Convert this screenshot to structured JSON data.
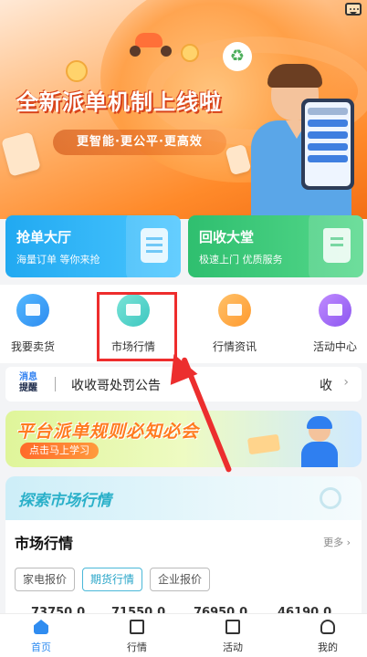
{
  "banner": {
    "title": "全新派单机制上线啦",
    "subtitle": "更智能·更公平·更高效"
  },
  "cards": [
    {
      "title": "抢单大厅",
      "subtitle": "海量订单 等你来抢",
      "color": "#21a9f1"
    },
    {
      "title": "回收大堂",
      "subtitle": "极速上门 优质服务",
      "color": "#2fbf6f"
    }
  ],
  "nav": [
    {
      "label": "我要卖货",
      "icon": "cart-icon"
    },
    {
      "label": "市场行情",
      "icon": "market-chart-icon"
    },
    {
      "label": "行情资讯",
      "icon": "news-icon"
    },
    {
      "label": "活动中心",
      "icon": "gift-icon"
    }
  ],
  "notice": {
    "tag_top": "消息",
    "tag_bottom": "提醒",
    "text": "收收哥处罚公告",
    "tail": "收"
  },
  "promo": {
    "title": "平台派单规则必知必会",
    "button": "点击马上学习"
  },
  "market": {
    "header": "探索市场行情",
    "title": "市场行情",
    "more": "更多 ›",
    "chips": [
      "家电报价",
      "期货行情",
      "企业报价"
    ],
    "active_chip": "期货行情",
    "prices": [
      "73750.0",
      "71550.0",
      "76950.0",
      "46190.0"
    ]
  },
  "tabs": [
    {
      "label": "首页",
      "active": true
    },
    {
      "label": "行情",
      "active": false
    },
    {
      "label": "活动",
      "active": false
    },
    {
      "label": "我的",
      "active": false
    }
  ],
  "accent_color": "#2f8cf0",
  "highlight_color": "#ee2d2d"
}
